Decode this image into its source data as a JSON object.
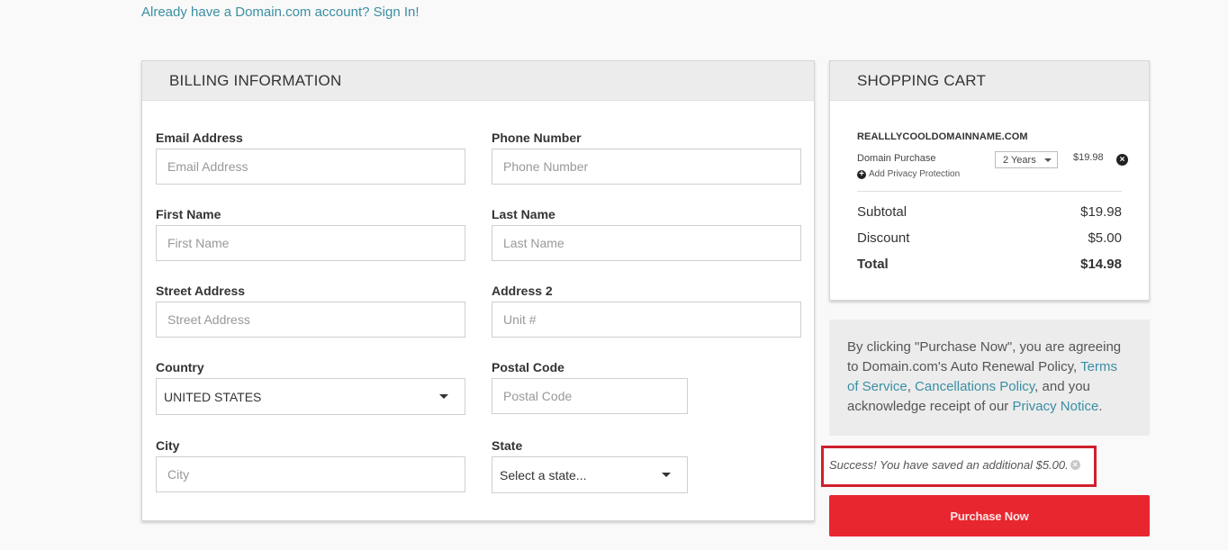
{
  "signin": {
    "text": "Already have a Domain.com account? Sign In!"
  },
  "billing": {
    "title": "BILLING INFORMATION",
    "fields": {
      "email": {
        "label": "Email Address",
        "placeholder": "Email Address",
        "value": ""
      },
      "phone": {
        "label": "Phone Number",
        "placeholder": "Phone Number",
        "value": ""
      },
      "first_name": {
        "label": "First Name",
        "placeholder": "First Name",
        "value": ""
      },
      "last_name": {
        "label": "Last Name",
        "placeholder": "Last Name",
        "value": ""
      },
      "street": {
        "label": "Street Address",
        "placeholder": "Street Address",
        "value": ""
      },
      "address2": {
        "label": "Address 2",
        "placeholder": "Unit #",
        "value": ""
      },
      "country": {
        "label": "Country",
        "selected": "UNITED STATES"
      },
      "postal": {
        "label": "Postal Code",
        "placeholder": "Postal Code",
        "value": ""
      },
      "city": {
        "label": "City",
        "placeholder": "City",
        "value": ""
      },
      "state": {
        "label": "State",
        "selected": "Select a state..."
      }
    }
  },
  "cart": {
    "title": "SHOPPING CART",
    "domain": "REALLLYCOOLDOMAINNAME.COM",
    "item": {
      "label": "Domain Purchase",
      "term": "2 Years",
      "price": "$19.98",
      "privacy_link": "Add Privacy Protection"
    },
    "totals": [
      {
        "label": "Subtotal",
        "value": "$19.98",
        "bold": false
      },
      {
        "label": "Discount",
        "value": "$5.00",
        "bold": false
      },
      {
        "label": "Total",
        "value": "$14.98",
        "bold": true
      }
    ]
  },
  "terms": {
    "text_1": "By clicking \"Purchase Now\", you are agreeing to Domain.com's Auto Renewal Policy, ",
    "link_terms": "Terms of Service",
    "sep_1": ", ",
    "link_cancel": "Cancellations Policy",
    "text_2": ", and you acknowledge receipt of our ",
    "link_privacy": "Privacy Notice",
    "text_3": "."
  },
  "success": {
    "message": "Success! You have saved an additional $5.00."
  },
  "purchase": {
    "label": "Purchase Now"
  },
  "colors": {
    "accent_link": "#3a8fa3",
    "purchase_red": "#e8262f",
    "highlight_red": "#d0202c"
  }
}
